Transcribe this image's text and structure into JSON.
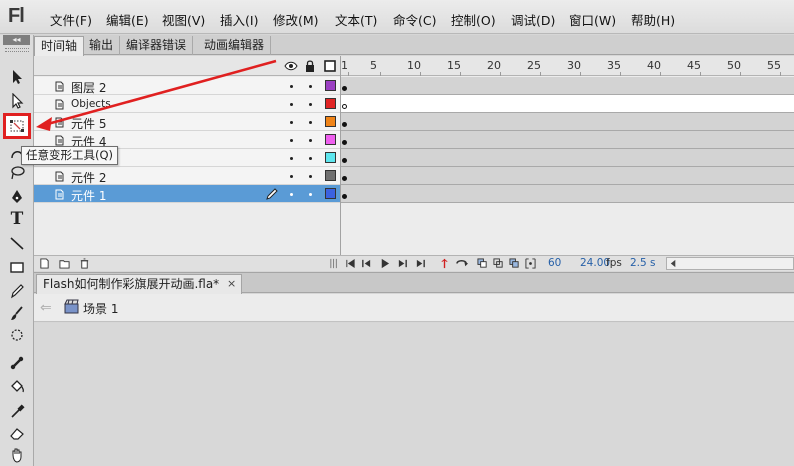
{
  "app": {
    "logo": "Fl"
  },
  "menu": [
    "文件(F)",
    "编辑(E)",
    "视图(V)",
    "插入(I)",
    "修改(M)",
    "文本(T)",
    "命令(C)",
    "控制(O)",
    "调试(D)",
    "窗口(W)",
    "帮助(H)"
  ],
  "toolpanel": {
    "collapse": "◂◂",
    "tools": [
      {
        "name": "selection-tool",
        "icon": "selection-arrow-icon"
      },
      {
        "name": "subselection-tool",
        "icon": "subselection-arrow-icon"
      },
      {
        "name": "free-transform-tool",
        "icon": "free-transform-icon",
        "selected": true
      },
      {
        "name": "gradient-transform-tool",
        "icon": "gradient-icon"
      },
      {
        "name": "lasso-tool",
        "icon": "lasso-icon"
      },
      {
        "name": "pen-tool",
        "icon": "pen-icon"
      },
      {
        "name": "text-tool",
        "icon": "text-icon",
        "label": "T"
      },
      {
        "name": "line-tool",
        "icon": "line-icon"
      },
      {
        "name": "rectangle-tool",
        "icon": "rectangle-icon"
      },
      {
        "name": "pencil-tool",
        "icon": "pencil-icon"
      },
      {
        "name": "brush-tool",
        "icon": "brush-icon"
      },
      {
        "name": "deco-tool",
        "icon": "deco-icon"
      },
      {
        "name": "bone-tool",
        "icon": "bone-icon"
      },
      {
        "name": "paint-bucket-tool",
        "icon": "paint-bucket-icon"
      },
      {
        "name": "eyedropper-tool",
        "icon": "eyedropper-icon"
      },
      {
        "name": "eraser-tool",
        "icon": "eraser-icon"
      },
      {
        "name": "hand-tool",
        "icon": "hand-icon"
      }
    ]
  },
  "tooltip": {
    "text": "任意变形工具(Q)"
  },
  "panel_tabs": [
    "时间轴",
    "输出",
    "编译器错误",
    "动画编辑器"
  ],
  "timeline": {
    "ruler": [
      "1",
      "5",
      "10",
      "15",
      "20",
      "25",
      "30",
      "35",
      "40",
      "45",
      "50",
      "55"
    ],
    "layers": [
      {
        "name": "图层 2",
        "color": "#9b3fc2",
        "selected": false,
        "keyframe": "filled",
        "white_frames": false
      },
      {
        "name": "Objects",
        "color": "#e02424",
        "selected": false,
        "keyframe": "empty",
        "white_frames": true
      },
      {
        "name": "元件 5",
        "color": "#f08418",
        "selected": false,
        "keyframe": "filled",
        "white_frames": false
      },
      {
        "name": "元件 4",
        "color": "#ee5fee",
        "selected": false,
        "keyframe": "filled",
        "white_frames": false
      },
      {
        "name": "",
        "color": "#5ee6ee",
        "selected": false,
        "keyframe": "filled",
        "white_frames": false
      },
      {
        "name": "元件 2",
        "color": "#707070",
        "selected": false,
        "keyframe": "filled",
        "white_frames": false
      },
      {
        "name": "元件 1",
        "color": "#3b62e0",
        "selected": true,
        "keyframe": "filled",
        "white_frames": false
      }
    ],
    "footer": {
      "current_frame": "60",
      "fps": "24.00",
      "fps_unit": "fps",
      "time": "2.5 s"
    }
  },
  "document": {
    "tab_title": "Flash如何制作彩旗展开动画.fla*",
    "close": "×"
  },
  "editbar": {
    "back": "⇐",
    "scene": "场景 1"
  },
  "annotation": {
    "color": "#e02020"
  }
}
